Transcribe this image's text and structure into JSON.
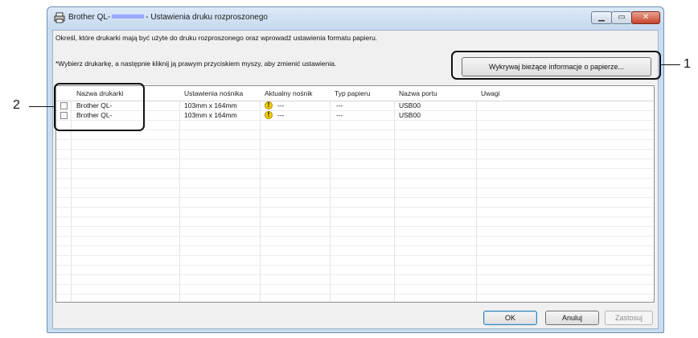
{
  "window": {
    "title_prefix": "Brother QL-",
    "title_suffix": "- Ustawienia druku rozproszonego",
    "min_glyph": "▁",
    "max_glyph": "▭",
    "close_glyph": "✕"
  },
  "instructions": {
    "description": "Określ, które drukarki mają być użyte do druku rozproszonego oraz wprowadź ustawienia formatu papieru.",
    "note": "*Wybierz drukarkę, a następnie kliknij ją prawym przyciskiem myszy, aby zmienić ustawienia."
  },
  "detect_button": {
    "label": "Wykrywaj bieżące informacje o papierze..."
  },
  "table": {
    "columns": [
      "Nazwa drukarki",
      "Ustawienia nośnika",
      "Aktualny nośnik",
      "Typ papieru",
      "Nazwa portu",
      "Uwagi"
    ],
    "rows": [
      {
        "checked": false,
        "printer": "Brother QL-",
        "media_setting": "103mm x 164mm",
        "current_media": "---",
        "paper_type": "---",
        "port": "USB00",
        "notes": ""
      },
      {
        "checked": false,
        "printer": "Brother QL-",
        "media_setting": "103mm x 164mm",
        "current_media": "---",
        "paper_type": "---",
        "port": "USB00",
        "notes": ""
      }
    ]
  },
  "buttons": {
    "ok": "OK",
    "cancel": "Anuluj",
    "apply": "Zastosuj"
  },
  "callouts": {
    "one": "1",
    "two": "2"
  },
  "icons": {
    "title_icon": "printer-icon",
    "warning_icon": "warning-icon"
  }
}
